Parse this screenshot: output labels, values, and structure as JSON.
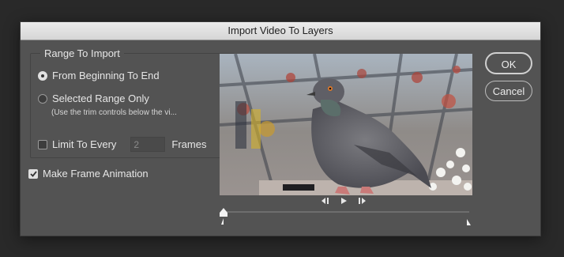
{
  "dialog": {
    "title": "Import Video To Layers"
  },
  "range_group": {
    "title": "Range To Import",
    "option_full": "From Beginning To End",
    "option_full_selected": true,
    "option_selected": "Selected Range Only",
    "option_selected_selected": false,
    "trim_hint": "(Use the trim controls below the vi...",
    "limit_label": "Limit To Every",
    "limit_checked": false,
    "limit_value": "2",
    "frames_label": "Frames"
  },
  "frame_animation": {
    "label": "Make Frame Animation",
    "checked": true
  },
  "buttons": {
    "ok": "OK",
    "cancel": "Cancel"
  },
  "playback": {
    "prev_icon": "step-back-icon",
    "play_icon": "play-icon",
    "next_icon": "step-forward-icon"
  }
}
